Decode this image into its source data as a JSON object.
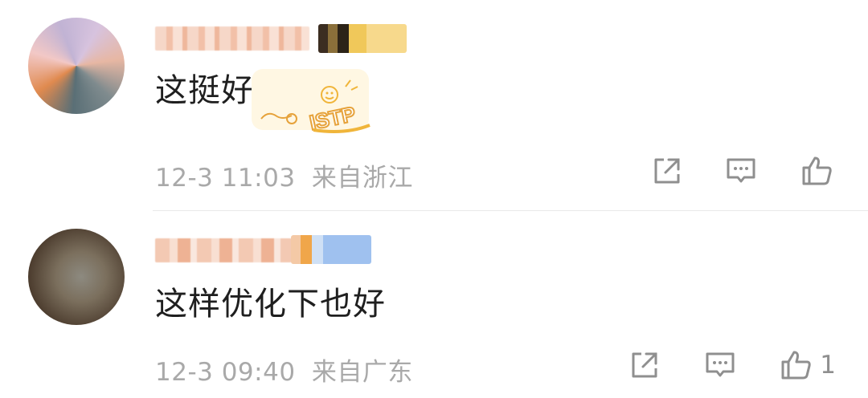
{
  "comments": [
    {
      "text": "这挺好的",
      "time": "12-3 11:03",
      "location": "来自浙江",
      "like_count": "",
      "sticker_text": "ISTP"
    },
    {
      "text": "这样优化下也好",
      "time": "12-3 09:40",
      "location": "来自广东",
      "like_count": "1"
    }
  ],
  "icons": {
    "share": "share-icon",
    "comment": "comment-icon",
    "like": "like-icon"
  },
  "colors": {
    "meta_gray": "#a9a9a9",
    "icon_gray": "#8f8f8f",
    "divider": "#e9e9e9",
    "sticker_accent": "#f0b53a"
  }
}
